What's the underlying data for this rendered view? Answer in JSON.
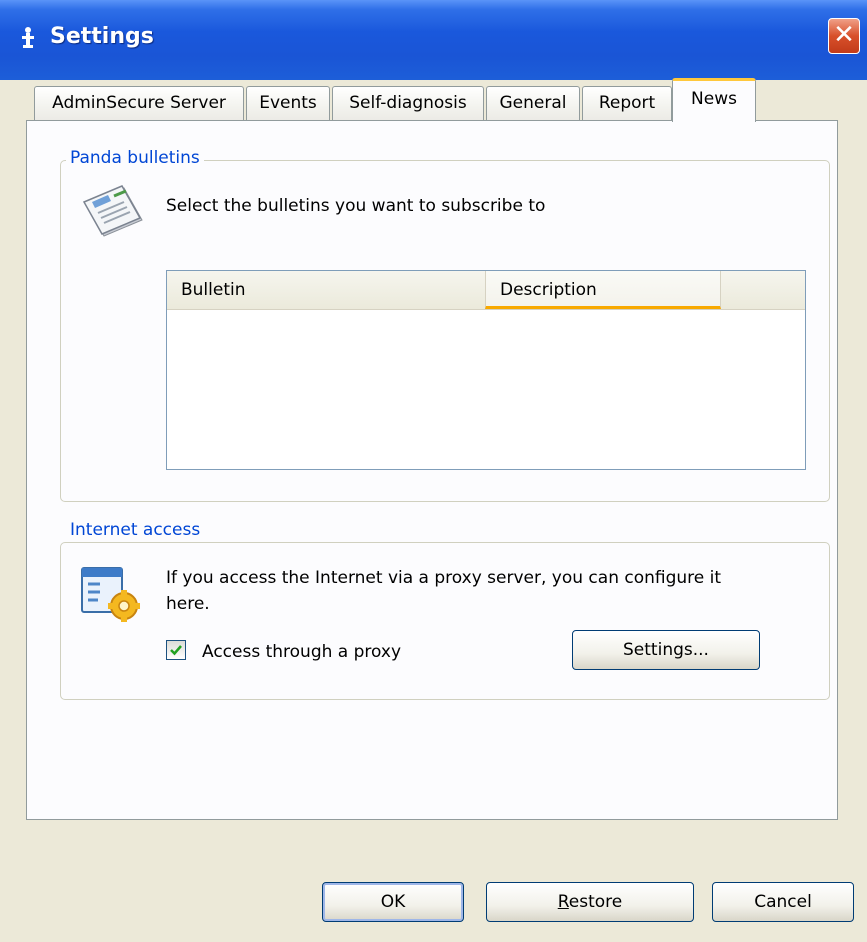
{
  "window": {
    "title": "Settings",
    "close_label": "✕"
  },
  "tabs": [
    {
      "label": "AdminSecure Server"
    },
    {
      "label": "Events"
    },
    {
      "label": "Self-diagnosis"
    },
    {
      "label": "General"
    },
    {
      "label": "Report"
    },
    {
      "label": "News",
      "active": true
    }
  ],
  "bulletins": {
    "group_label": "Panda bulletins",
    "instruction": "Select the bulletins you want to subscribe to",
    "icon": "newspaper-icon",
    "columns": [
      "Bulletin",
      "Description"
    ],
    "rows": []
  },
  "internet": {
    "group_label": "Internet access",
    "icon": "proxy-settings-icon",
    "description_line1": "If you access the Internet via a proxy server, you can configure it",
    "description_line2": "here.",
    "proxy_checkbox_label": "Access through a proxy",
    "proxy_checked": true,
    "settings_button": "Settings..."
  },
  "footer": {
    "ok": "OK",
    "restore_first": "R",
    "restore_rest": "estore",
    "cancel": "Cancel"
  },
  "colors": {
    "titlebar": "#1a55d6",
    "group_label": "#0046d5",
    "tab_highlight": "#ffc83c",
    "sort_indicator": "#f8a900"
  }
}
